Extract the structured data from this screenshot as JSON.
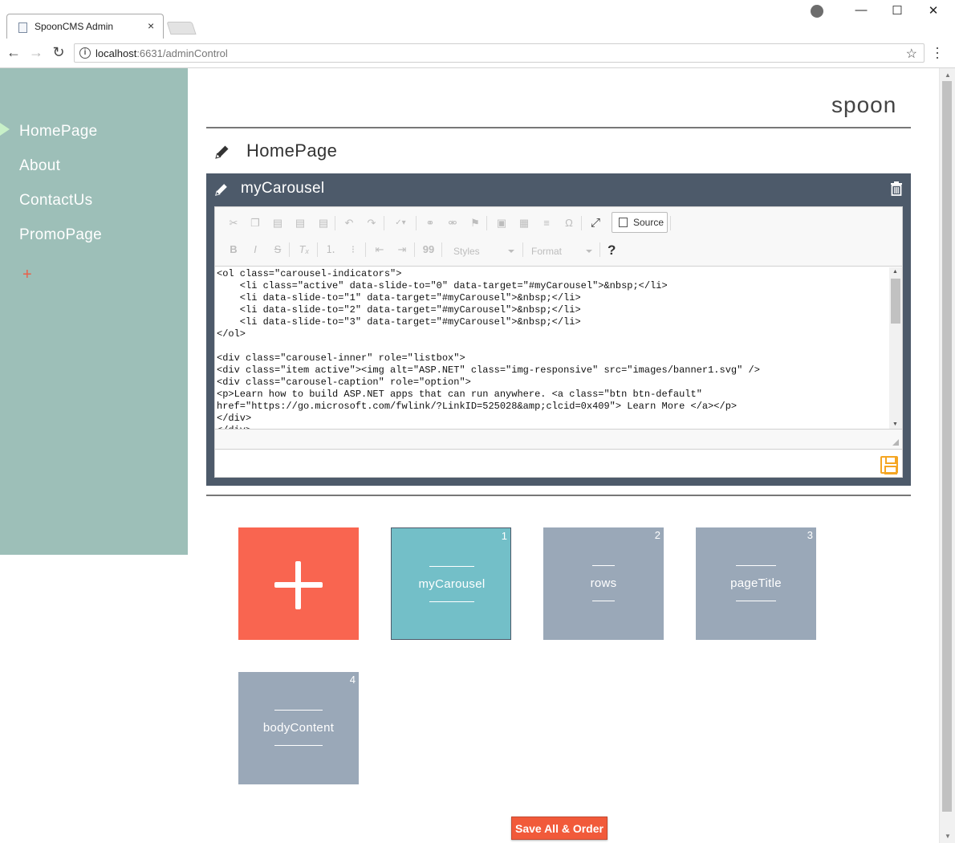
{
  "browser": {
    "tab_title": "SpoonCMS Admin",
    "url_host": "localhost",
    "url_rest": ":6631/adminControl",
    "controls": {
      "minimize": "—",
      "maximize": "☐",
      "close": "✕"
    }
  },
  "sidebar": {
    "items": [
      {
        "label": "HomePage",
        "active": true
      },
      {
        "label": "About"
      },
      {
        "label": "ContactUs"
      },
      {
        "label": "PromoPage"
      }
    ],
    "add_label": "+"
  },
  "brand": "spoon",
  "page": {
    "title": "HomePage"
  },
  "panel": {
    "title": "myCarousel",
    "editor": {
      "source_label": "Source",
      "styles_label": "Styles",
      "format_label": "Format",
      "help_label": "?",
      "code": "<ol class=\"carousel-indicators\">\n    <li class=\"active\" data-slide-to=\"0\" data-target=\"#myCarousel\">&nbsp;</li>\n    <li data-slide-to=\"1\" data-target=\"#myCarousel\">&nbsp;</li>\n    <li data-slide-to=\"2\" data-target=\"#myCarousel\">&nbsp;</li>\n    <li data-slide-to=\"3\" data-target=\"#myCarousel\">&nbsp;</li>\n</ol>\n\n<div class=\"carousel-inner\" role=\"listbox\">\n<div class=\"item active\"><img alt=\"ASP.NET\" class=\"img-responsive\" src=\"images/banner1.svg\" />\n<div class=\"carousel-caption\" role=\"option\">\n<p>Learn how to build ASP.NET apps that can run anywhere. <a class=\"btn btn-default\"\nhref=\"https://go.microsoft.com/fwlink/?LinkID=525028&amp;clcid=0x409\"> Learn More </a></p>\n</div>\n</div>"
    }
  },
  "tiles": [
    {
      "label": "myCarousel",
      "num": "1"
    },
    {
      "label": "rows",
      "num": "2"
    },
    {
      "label": "pageTitle",
      "num": "3"
    },
    {
      "label": "bodyContent",
      "num": "4"
    }
  ],
  "save_all_label": "Save All & Order",
  "colors": {
    "sidebar": "#9dbfb8",
    "panel": "#4d5a6a",
    "accent": "#f96550",
    "tile_active": "#73bfc8",
    "tile_muted": "#9aa8b8",
    "save_icon": "#f5a623"
  }
}
